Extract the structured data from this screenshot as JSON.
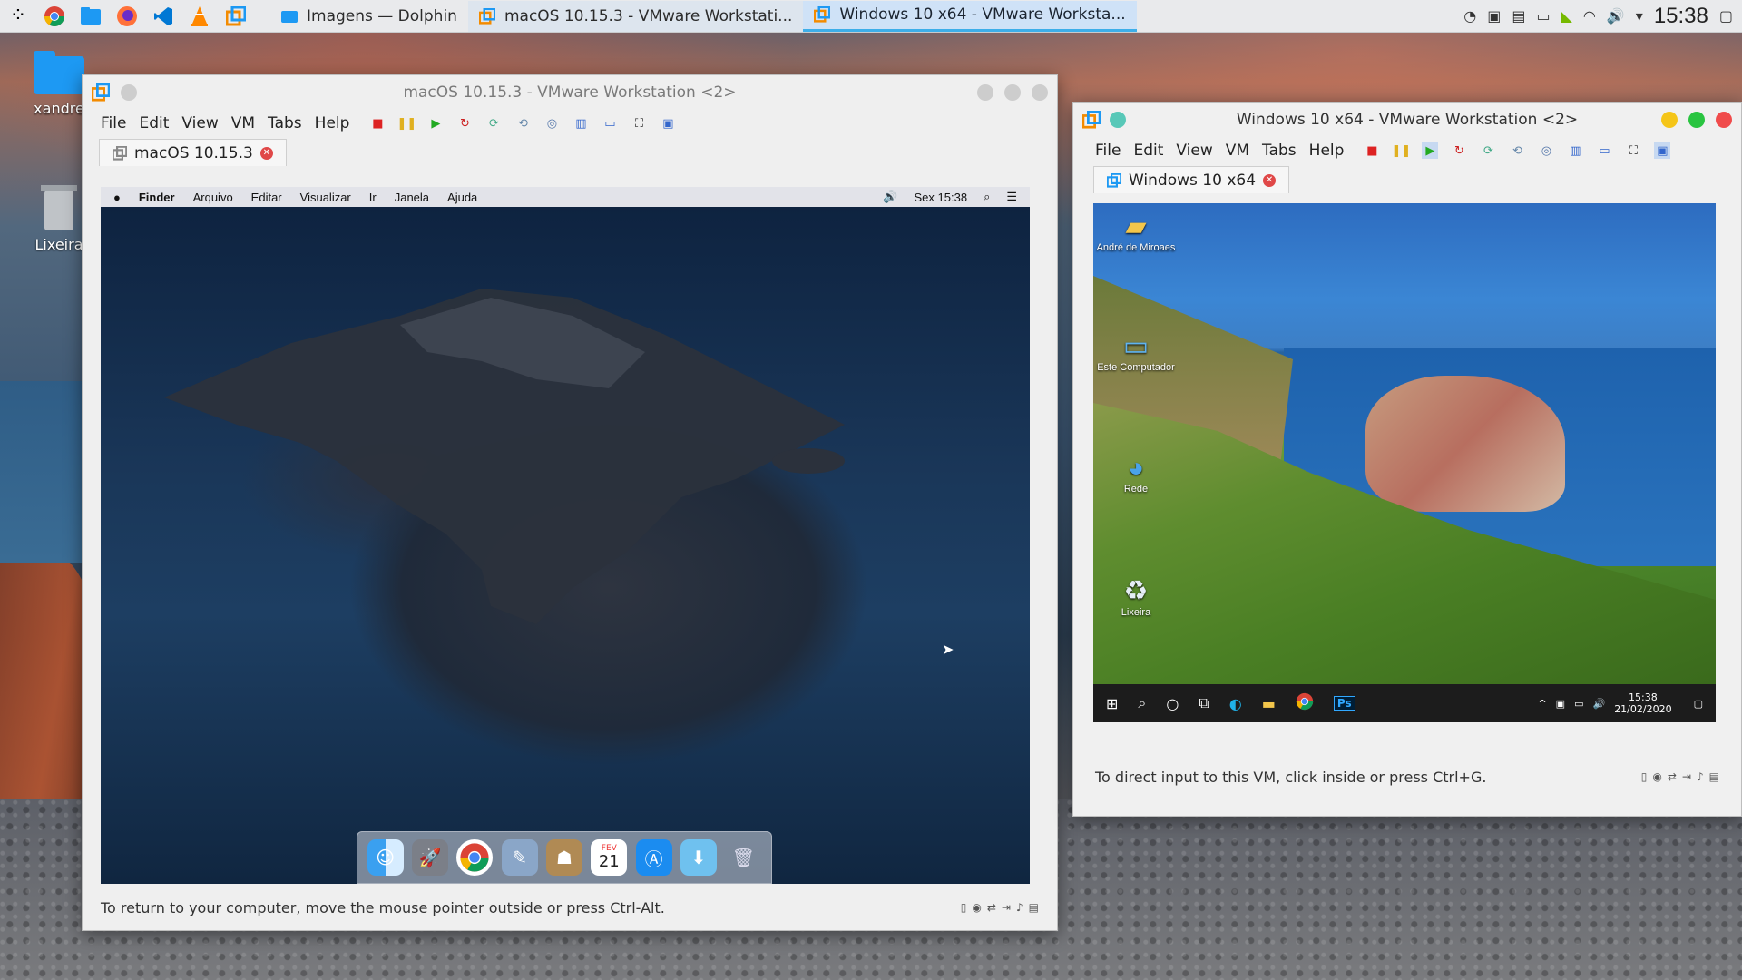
{
  "panel": {
    "launchers": [
      "app-launcher",
      "chrome",
      "dolphin",
      "firefox",
      "vscode",
      "vlc",
      "vmware"
    ],
    "tasks": [
      {
        "label": "Imagens — Dolphin"
      },
      {
        "label": "macOS 10.15.3 - VMware Workstati..."
      },
      {
        "label": "Windows 10 x64 - VMware Worksta..."
      }
    ],
    "clock": "15:38"
  },
  "desktop": {
    "icons": [
      {
        "label": "xandre"
      },
      {
        "label": "Lixeira"
      }
    ]
  },
  "vm_mac": {
    "title": "macOS 10.15.3 - VMware Workstation <2>",
    "menu": [
      "File",
      "Edit",
      "View",
      "VM",
      "Tabs",
      "Help"
    ],
    "tab_label": "macOS 10.15.3",
    "status": "To return to your computer, move the mouse pointer outside or press Ctrl-Alt.",
    "guest": {
      "menubar": [
        "Finder",
        "Arquivo",
        "Editar",
        "Visualizar",
        "Ir",
        "Janela",
        "Ajuda"
      ],
      "time": "Sex 15:38",
      "dock": [
        "finder",
        "launchpad",
        "chrome",
        "preview",
        "contacts",
        "calendar",
        "app-store",
        "downloads",
        "trash"
      ],
      "calendar_month": "FEV",
      "calendar_day": "21"
    }
  },
  "vm_win": {
    "title": "Windows 10 x64 - VMware Workstation <2>",
    "menu": [
      "File",
      "Edit",
      "View",
      "VM",
      "Tabs",
      "Help"
    ],
    "tab_label": "Windows 10 x64",
    "status": "To direct input to this VM, click inside or press Ctrl+G.",
    "guest": {
      "icons": [
        {
          "label": "André de Miroaes"
        },
        {
          "label": "Este Computador"
        },
        {
          "label": "Rede"
        },
        {
          "label": "Lixeira"
        }
      ],
      "clock_time": "15:38",
      "clock_date": "21/02/2020",
      "ps_label": "Ps"
    }
  }
}
